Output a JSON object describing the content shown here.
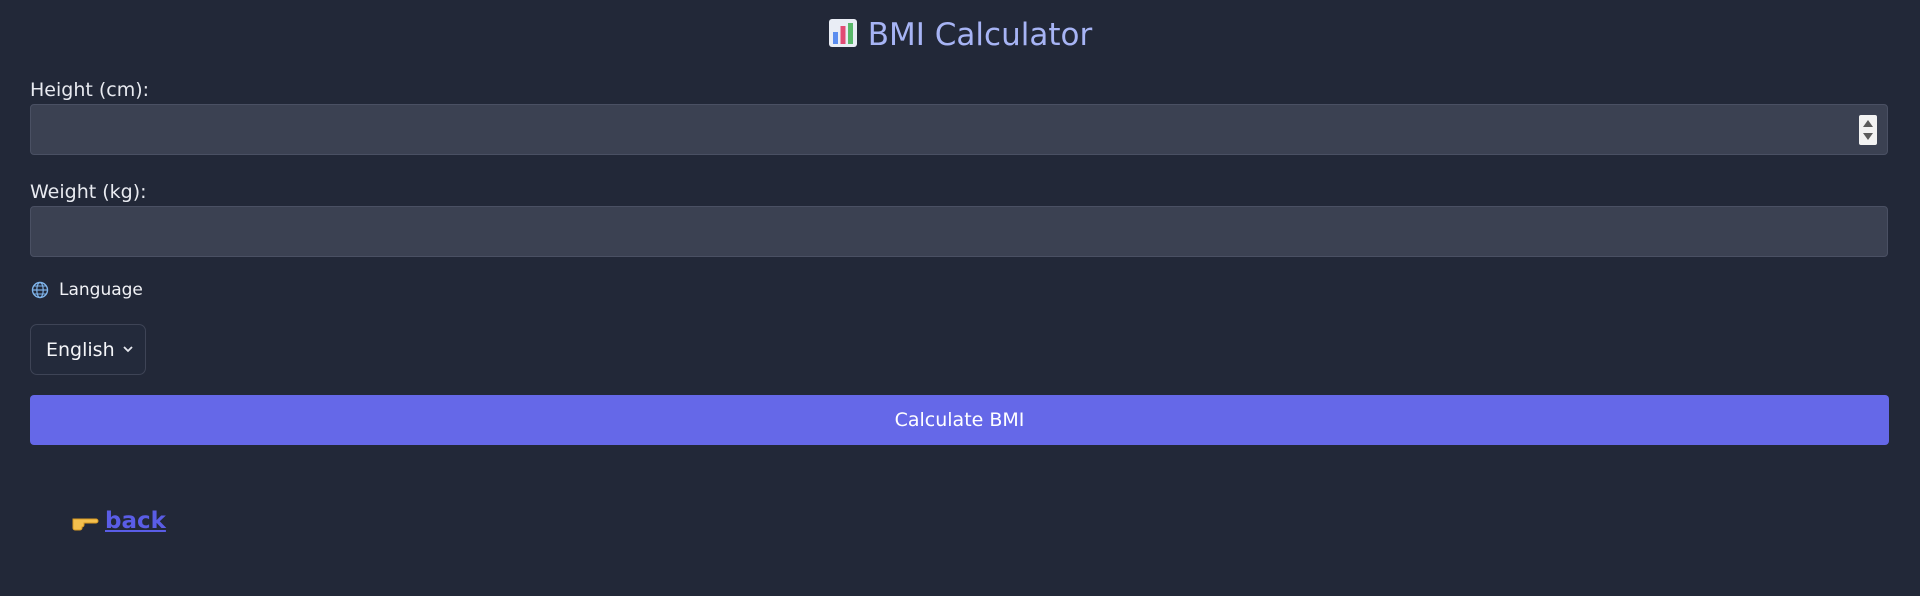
{
  "header": {
    "title": "BMI Calculator",
    "icon": "bar-chart-icon"
  },
  "form": {
    "height_label": "Height (cm):",
    "height_value": "",
    "weight_label": "Weight (kg):",
    "weight_value": "",
    "language_label": "Language",
    "language_icon": "globe-icon",
    "language_selected": "English",
    "calculate_label": "Calculate BMI"
  },
  "footer": {
    "back_label": "back",
    "back_icon": "pointing-hand-icon"
  },
  "colors": {
    "background": "#222838",
    "title": "#a7b4f5",
    "input_bg": "#3b4152",
    "button": "#6568e8",
    "link": "#5a5de6"
  }
}
